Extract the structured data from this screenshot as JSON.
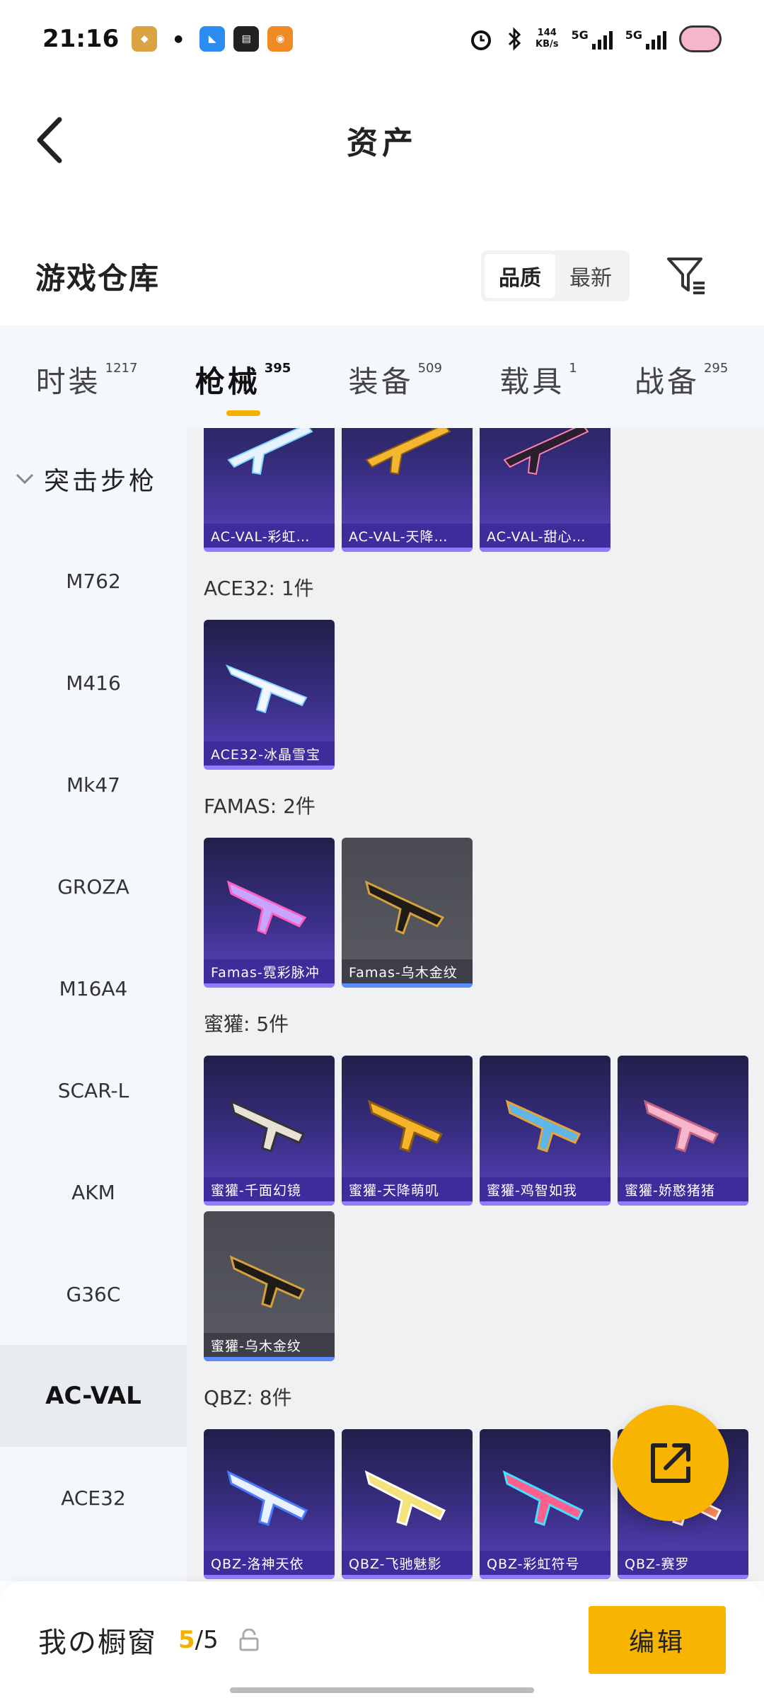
{
  "status": {
    "time": "21:16",
    "net_speed_value": "144",
    "net_speed_unit": "KB/s",
    "sim1": "5G",
    "sim2": "5G"
  },
  "header": {
    "title": "资产"
  },
  "warehouse": {
    "title": "游戏仓库",
    "sort_options": [
      "品质",
      "最新"
    ],
    "active_sort": "品质"
  },
  "tabs": [
    {
      "label": "时装",
      "count": "1217"
    },
    {
      "label": "枪械",
      "count": "395"
    },
    {
      "label": "装备",
      "count": "509"
    },
    {
      "label": "载具",
      "count": "1"
    },
    {
      "label": "战备",
      "count": "295"
    }
  ],
  "active_tab": "枪械",
  "sidebar": {
    "group": "突击步枪",
    "items": [
      "M762",
      "M416",
      "Mk47",
      "GROZA",
      "M16A4",
      "SCAR-L",
      "AKM",
      "G36C",
      "AC-VAL",
      "ACE32"
    ],
    "active": "AC-VAL"
  },
  "content": {
    "top_cards": [
      "AC-VAL-彩虹…",
      "AC-VAL-天降…",
      "AC-VAL-甜心…"
    ],
    "sections": [
      {
        "title": "ACE32: 1件",
        "cards": [
          {
            "name": "ACE32-冰晶雪宝",
            "style": "purple"
          }
        ]
      },
      {
        "title": "FAMAS: 2件",
        "cards": [
          {
            "name": "Famas-霓彩脉冲",
            "style": "purple"
          },
          {
            "name": "Famas-乌木金纹",
            "style": "gray"
          }
        ]
      },
      {
        "title": "蜜獾: 5件",
        "cards": [
          {
            "name": "蜜獾-千面幻镜",
            "style": "purple"
          },
          {
            "name": "蜜獾-天降萌叽",
            "style": "purple"
          },
          {
            "name": "蜜獾-鸡智如我",
            "style": "purple"
          },
          {
            "name": "蜜獾-娇憨猪猪",
            "style": "purple"
          },
          {
            "name": "蜜獾-乌木金纹",
            "style": "gray"
          }
        ]
      },
      {
        "title": "QBZ: 8件",
        "cards": [
          {
            "name": "QBZ-洛神天依",
            "style": "purple"
          },
          {
            "name": "QBZ-飞驰魅影",
            "style": "purple"
          },
          {
            "name": "QBZ-彩虹符号",
            "style": "purple"
          },
          {
            "name": "QBZ-赛罗",
            "style": "purple"
          }
        ]
      }
    ]
  },
  "bottom": {
    "showcase_label": "我の橱窗",
    "showcase_current": "5",
    "showcase_total": "/5",
    "edit_label": "编辑"
  },
  "colors": {
    "accent": "#f7b400",
    "card_purple": "#3a2f86",
    "card_gray": "#55565e"
  },
  "icons": [
    "back-arrow-icon",
    "filter-icon",
    "chevron-down-icon",
    "share-icon",
    "lock-icon"
  ]
}
